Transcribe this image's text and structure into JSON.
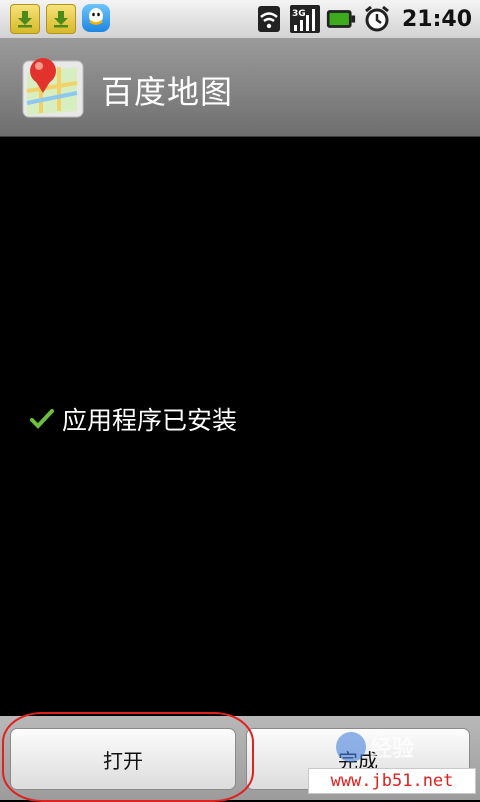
{
  "status_bar": {
    "notifications": [
      "download-icon",
      "download-icon",
      "qq-icon"
    ],
    "indicators": [
      "wifi-icon",
      "3g-signal-icon",
      "battery-icon",
      "alarm-icon"
    ],
    "time": "21:40"
  },
  "title_bar": {
    "app_icon": "baidu-maps-icon",
    "app_name": "百度地图"
  },
  "content": {
    "status_icon": "checkmark-icon",
    "status_text": "应用程序已安装"
  },
  "buttons": {
    "open_label": "打开",
    "done_label": "完成"
  },
  "watermark": {
    "text": "经验",
    "site": "www.jb51.net"
  },
  "colors": {
    "annotation": "#e12020",
    "check": "#6cbf3c"
  }
}
